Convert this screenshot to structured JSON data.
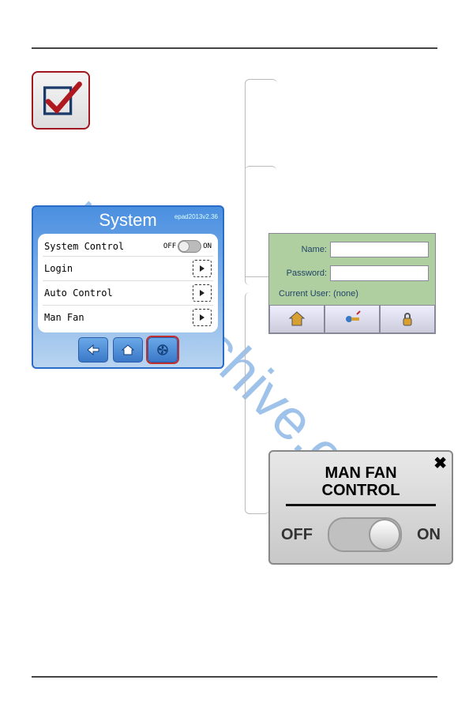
{
  "watermark": "manualshive.com",
  "system": {
    "title": "System",
    "version": "epad2013v2.36",
    "rows": {
      "system_control": "System Control",
      "login": "Login",
      "auto_control": "Auto Control",
      "man_fan": "Man Fan"
    },
    "toggle": {
      "off": "OFF",
      "on": "ON"
    }
  },
  "login": {
    "name_label": "Name:",
    "password_label": "Password:",
    "current_user_label": "Current User:",
    "current_user_value": "(none)"
  },
  "manfan": {
    "title_line1": "MAN FAN",
    "title_line2": "CONTROL",
    "off": "OFF",
    "on": "ON"
  }
}
